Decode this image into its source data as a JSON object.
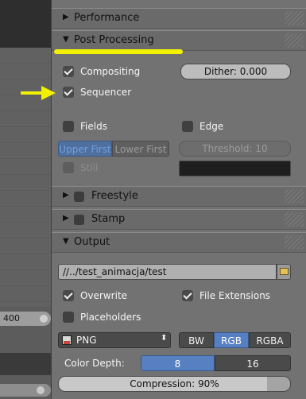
{
  "left": {
    "field_value": "400"
  },
  "sections": {
    "performance": {
      "label": "Performance",
      "expanded": false
    },
    "post_processing": {
      "label": "Post Processing",
      "expanded": true,
      "compositing": {
        "label": "Compositing",
        "checked": true
      },
      "dither": {
        "label": "Dither:",
        "value": "0.000"
      },
      "sequencer": {
        "label": "Sequencer",
        "checked": true
      },
      "fields": {
        "label": "Fields",
        "checked": false
      },
      "edge": {
        "label": "Edge",
        "checked": false
      },
      "field_order": {
        "upper": "Upper First",
        "lower": "Lower First",
        "selected": "Upper First"
      },
      "threshold": {
        "label": "Threshold:",
        "value": "10"
      },
      "still": {
        "label": "Still",
        "checked": false
      }
    },
    "freestyle": {
      "label": "Freestyle",
      "expanded": false,
      "enabled": false
    },
    "stamp": {
      "label": "Stamp",
      "expanded": false,
      "enabled": false
    },
    "output": {
      "label": "Output",
      "expanded": true,
      "path": "//../test_animacja/test",
      "overwrite": {
        "label": "Overwrite",
        "checked": true
      },
      "file_extensions": {
        "label": "File Extensions",
        "checked": true
      },
      "placeholders": {
        "label": "Placeholders",
        "checked": false
      },
      "format": {
        "value": "PNG"
      },
      "color_modes": [
        "BW",
        "RGB",
        "RGBA"
      ],
      "color_mode_selected": "RGB",
      "color_depth": {
        "label": "Color Depth:",
        "options": [
          "8",
          "16"
        ],
        "selected": "8"
      },
      "compression": {
        "label": "Compression:",
        "value": "90%",
        "fraction": 0.9
      }
    }
  },
  "colors": {
    "accent_blue": "#5680c2",
    "highlight_yellow": "#f2f200",
    "background": "#727272"
  }
}
